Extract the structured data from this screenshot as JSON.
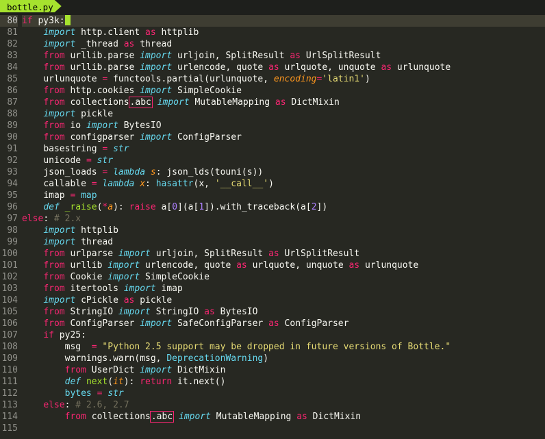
{
  "tab_title": "bottle.py",
  "first_line": 80,
  "cursor_line": 80,
  "lines": [
    {
      "n": 80,
      "t": [
        {
          "c": "kw",
          "s": "if"
        },
        {
          "c": "name",
          "s": " py3k:"
        }
      ],
      "hl": true
    },
    {
      "n": 81,
      "i": 2,
      "t": [
        {
          "c": "kw2",
          "s": "import"
        },
        {
          "c": "name",
          "s": " http.client "
        },
        {
          "c": "kw",
          "s": "as"
        },
        {
          "c": "name",
          "s": " httplib"
        }
      ]
    },
    {
      "n": 82,
      "i": 2,
      "t": [
        {
          "c": "kw2",
          "s": "import"
        },
        {
          "c": "name",
          "s": " _thread "
        },
        {
          "c": "kw",
          "s": "as"
        },
        {
          "c": "name",
          "s": " thread"
        }
      ]
    },
    {
      "n": 83,
      "i": 2,
      "t": [
        {
          "c": "kw",
          "s": "from"
        },
        {
          "c": "name",
          "s": " urllib.parse "
        },
        {
          "c": "kw2",
          "s": "import"
        },
        {
          "c": "name",
          "s": " urljoin, SplitResult "
        },
        {
          "c": "kw",
          "s": "as"
        },
        {
          "c": "name",
          "s": " UrlSplitResult"
        }
      ]
    },
    {
      "n": 84,
      "i": 2,
      "t": [
        {
          "c": "kw",
          "s": "from"
        },
        {
          "c": "name",
          "s": " urllib.parse "
        },
        {
          "c": "kw2",
          "s": "import"
        },
        {
          "c": "name",
          "s": " urlencode, quote "
        },
        {
          "c": "kw",
          "s": "as"
        },
        {
          "c": "name",
          "s": " urlquote, unquote "
        },
        {
          "c": "kw",
          "s": "as"
        },
        {
          "c": "name",
          "s": " urlunquote"
        }
      ]
    },
    {
      "n": 85,
      "i": 2,
      "t": [
        {
          "c": "name",
          "s": "urlunquote "
        },
        {
          "c": "kw",
          "s": "="
        },
        {
          "c": "name",
          "s": " functools.partial(urlunquote, "
        },
        {
          "c": "arg",
          "s": "encoding"
        },
        {
          "c": "kw",
          "s": "="
        },
        {
          "c": "str",
          "s": "'latin1'"
        },
        {
          "c": "name",
          "s": ")"
        }
      ]
    },
    {
      "n": 86,
      "i": 2,
      "t": [
        {
          "c": "kw",
          "s": "from"
        },
        {
          "c": "name",
          "s": " http.cookies "
        },
        {
          "c": "kw2",
          "s": "import"
        },
        {
          "c": "name",
          "s": " SimpleCookie"
        }
      ]
    },
    {
      "n": 87,
      "i": 2,
      "t": [
        {
          "c": "kw",
          "s": "from"
        },
        {
          "c": "name",
          "s": " collections"
        },
        {
          "c": "err",
          "s": ".abc"
        },
        {
          "c": "name",
          "s": " "
        },
        {
          "c": "kw2",
          "s": "import"
        },
        {
          "c": "name",
          "s": " MutableMapping "
        },
        {
          "c": "kw",
          "s": "as"
        },
        {
          "c": "name",
          "s": " DictMixin"
        }
      ]
    },
    {
      "n": 88,
      "i": 2,
      "t": [
        {
          "c": "kw2",
          "s": "import"
        },
        {
          "c": "name",
          "s": " pickle"
        }
      ]
    },
    {
      "n": 89,
      "i": 2,
      "t": [
        {
          "c": "kw",
          "s": "from"
        },
        {
          "c": "name",
          "s": " io "
        },
        {
          "c": "kw2",
          "s": "import"
        },
        {
          "c": "name",
          "s": " BytesIO"
        }
      ]
    },
    {
      "n": 90,
      "i": 2,
      "t": [
        {
          "c": "kw",
          "s": "from"
        },
        {
          "c": "name",
          "s": " configparser "
        },
        {
          "c": "kw2",
          "s": "import"
        },
        {
          "c": "name",
          "s": " ConfigParser"
        }
      ]
    },
    {
      "n": 91,
      "i": 2,
      "t": [
        {
          "c": "name",
          "s": "basestring "
        },
        {
          "c": "kw",
          "s": "="
        },
        {
          "c": "name",
          "s": " "
        },
        {
          "c": "def",
          "s": "str"
        }
      ]
    },
    {
      "n": 92,
      "i": 2,
      "t": [
        {
          "c": "name",
          "s": "unicode "
        },
        {
          "c": "kw",
          "s": "="
        },
        {
          "c": "name",
          "s": " "
        },
        {
          "c": "def",
          "s": "str"
        }
      ]
    },
    {
      "n": 93,
      "i": 2,
      "t": [
        {
          "c": "name",
          "s": "json_loads "
        },
        {
          "c": "kw",
          "s": "="
        },
        {
          "c": "name",
          "s": " "
        },
        {
          "c": "def",
          "s": "lambda"
        },
        {
          "c": "name",
          "s": " "
        },
        {
          "c": "arg",
          "s": "s"
        },
        {
          "c": "name",
          "s": ": json_lds(touni(s))"
        }
      ]
    },
    {
      "n": 94,
      "i": 2,
      "t": [
        {
          "c": "name",
          "s": "callable "
        },
        {
          "c": "kw",
          "s": "="
        },
        {
          "c": "name",
          "s": " "
        },
        {
          "c": "def",
          "s": "lambda"
        },
        {
          "c": "name",
          "s": " "
        },
        {
          "c": "arg",
          "s": "x"
        },
        {
          "c": "name",
          "s": ": "
        },
        {
          "c": "imp",
          "s": "hasattr"
        },
        {
          "c": "name",
          "s": "(x, "
        },
        {
          "c": "str",
          "s": "'__call__'"
        },
        {
          "c": "name",
          "s": ")"
        }
      ]
    },
    {
      "n": 95,
      "i": 2,
      "t": [
        {
          "c": "name",
          "s": "imap "
        },
        {
          "c": "kw",
          "s": "="
        },
        {
          "c": "name",
          "s": " "
        },
        {
          "c": "imp",
          "s": "map"
        }
      ]
    },
    {
      "n": 96,
      "i": 2,
      "t": [
        {
          "c": "def",
          "s": "def"
        },
        {
          "c": "name",
          "s": " "
        },
        {
          "c": "func",
          "s": "_raise"
        },
        {
          "c": "name",
          "s": "("
        },
        {
          "c": "kw",
          "s": "*"
        },
        {
          "c": "arg",
          "s": "a"
        },
        {
          "c": "name",
          "s": "): "
        },
        {
          "c": "kw",
          "s": "raise"
        },
        {
          "c": "name",
          "s": " a["
        },
        {
          "c": "num",
          "s": "0"
        },
        {
          "c": "name",
          "s": "](a["
        },
        {
          "c": "num",
          "s": "1"
        },
        {
          "c": "name",
          "s": "]).with_traceback(a["
        },
        {
          "c": "num",
          "s": "2"
        },
        {
          "c": "name",
          "s": "])"
        }
      ]
    },
    {
      "n": 97,
      "i": 0,
      "t": [
        {
          "c": "kw",
          "s": "else"
        },
        {
          "c": "name",
          "s": ": "
        },
        {
          "c": "cmt",
          "s": "# 2.x"
        }
      ]
    },
    {
      "n": 98,
      "i": 2,
      "t": [
        {
          "c": "kw2",
          "s": "import"
        },
        {
          "c": "name",
          "s": " httplib"
        }
      ]
    },
    {
      "n": 99,
      "i": 2,
      "t": [
        {
          "c": "kw2",
          "s": "import"
        },
        {
          "c": "name",
          "s": " thread"
        }
      ]
    },
    {
      "n": 100,
      "i": 2,
      "t": [
        {
          "c": "kw",
          "s": "from"
        },
        {
          "c": "name",
          "s": " urlparse "
        },
        {
          "c": "kw2",
          "s": "import"
        },
        {
          "c": "name",
          "s": " urljoin, SplitResult "
        },
        {
          "c": "kw",
          "s": "as"
        },
        {
          "c": "name",
          "s": " UrlSplitResult"
        }
      ]
    },
    {
      "n": 101,
      "i": 2,
      "t": [
        {
          "c": "kw",
          "s": "from"
        },
        {
          "c": "name",
          "s": " urllib "
        },
        {
          "c": "kw2",
          "s": "import"
        },
        {
          "c": "name",
          "s": " urlencode, quote "
        },
        {
          "c": "kw",
          "s": "as"
        },
        {
          "c": "name",
          "s": " urlquote, unquote "
        },
        {
          "c": "kw",
          "s": "as"
        },
        {
          "c": "name",
          "s": " urlunquote"
        }
      ]
    },
    {
      "n": 102,
      "i": 2,
      "t": [
        {
          "c": "kw",
          "s": "from"
        },
        {
          "c": "name",
          "s": " Cookie "
        },
        {
          "c": "kw2",
          "s": "import"
        },
        {
          "c": "name",
          "s": " SimpleCookie"
        }
      ]
    },
    {
      "n": 103,
      "i": 2,
      "t": [
        {
          "c": "kw",
          "s": "from"
        },
        {
          "c": "name",
          "s": " itertools "
        },
        {
          "c": "kw2",
          "s": "import"
        },
        {
          "c": "name",
          "s": " imap"
        }
      ]
    },
    {
      "n": 104,
      "i": 2,
      "t": [
        {
          "c": "kw2",
          "s": "import"
        },
        {
          "c": "name",
          "s": " cPickle "
        },
        {
          "c": "kw",
          "s": "as"
        },
        {
          "c": "name",
          "s": " pickle"
        }
      ]
    },
    {
      "n": 105,
      "i": 2,
      "t": [
        {
          "c": "kw",
          "s": "from"
        },
        {
          "c": "name",
          "s": " StringIO "
        },
        {
          "c": "kw2",
          "s": "import"
        },
        {
          "c": "name",
          "s": " StringIO "
        },
        {
          "c": "kw",
          "s": "as"
        },
        {
          "c": "name",
          "s": " BytesIO"
        }
      ]
    },
    {
      "n": 106,
      "i": 2,
      "t": [
        {
          "c": "kw",
          "s": "from"
        },
        {
          "c": "name",
          "s": " ConfigParser "
        },
        {
          "c": "kw2",
          "s": "import"
        },
        {
          "c": "name",
          "s": " SafeConfigParser "
        },
        {
          "c": "kw",
          "s": "as"
        },
        {
          "c": "name",
          "s": " ConfigParser"
        }
      ]
    },
    {
      "n": 107,
      "i": 2,
      "t": [
        {
          "c": "kw",
          "s": "if"
        },
        {
          "c": "name",
          "s": " py25:"
        }
      ]
    },
    {
      "n": 108,
      "i": 3,
      "t": [
        {
          "c": "name",
          "s": "msg  "
        },
        {
          "c": "kw",
          "s": "="
        },
        {
          "c": "name",
          "s": " "
        },
        {
          "c": "str",
          "s": "\"Python 2.5 support may be dropped in future versions of Bottle.\""
        }
      ]
    },
    {
      "n": 109,
      "i": 3,
      "t": [
        {
          "c": "name",
          "s": "warnings.warn(msg, "
        },
        {
          "c": "imp",
          "s": "DeprecationWarning"
        },
        {
          "c": "name",
          "s": ")"
        }
      ]
    },
    {
      "n": 110,
      "i": 3,
      "t": [
        {
          "c": "kw",
          "s": "from"
        },
        {
          "c": "name",
          "s": " UserDict "
        },
        {
          "c": "kw2",
          "s": "import"
        },
        {
          "c": "name",
          "s": " DictMixin"
        }
      ]
    },
    {
      "n": 111,
      "i": 3,
      "t": [
        {
          "c": "def",
          "s": "def"
        },
        {
          "c": "name",
          "s": " "
        },
        {
          "c": "func",
          "s": "next"
        },
        {
          "c": "name",
          "s": "("
        },
        {
          "c": "arg",
          "s": "it"
        },
        {
          "c": "name",
          "s": "): "
        },
        {
          "c": "kw",
          "s": "return"
        },
        {
          "c": "name",
          "s": " it.next()"
        }
      ]
    },
    {
      "n": 112,
      "i": 3,
      "t": [
        {
          "c": "imp",
          "s": "bytes"
        },
        {
          "c": "name",
          "s": " "
        },
        {
          "c": "kw",
          "s": "="
        },
        {
          "c": "name",
          "s": " "
        },
        {
          "c": "def",
          "s": "str"
        }
      ]
    },
    {
      "n": 113,
      "i": 2,
      "t": [
        {
          "c": "kw",
          "s": "else"
        },
        {
          "c": "name",
          "s": ": "
        },
        {
          "c": "cmt",
          "s": "# 2.6, 2.7"
        }
      ]
    },
    {
      "n": 114,
      "i": 3,
      "t": [
        {
          "c": "kw",
          "s": "from"
        },
        {
          "c": "name",
          "s": " collections"
        },
        {
          "c": "err",
          "s": ".abc"
        },
        {
          "c": "name",
          "s": " "
        },
        {
          "c": "kw2",
          "s": "import"
        },
        {
          "c": "name",
          "s": " MutableMapping "
        },
        {
          "c": "kw",
          "s": "as"
        },
        {
          "c": "name",
          "s": " DictMixin"
        }
      ]
    },
    {
      "n": 115,
      "i": 3,
      "t": [
        {
          "c": "cmt",
          "s": ""
        }
      ]
    }
  ]
}
